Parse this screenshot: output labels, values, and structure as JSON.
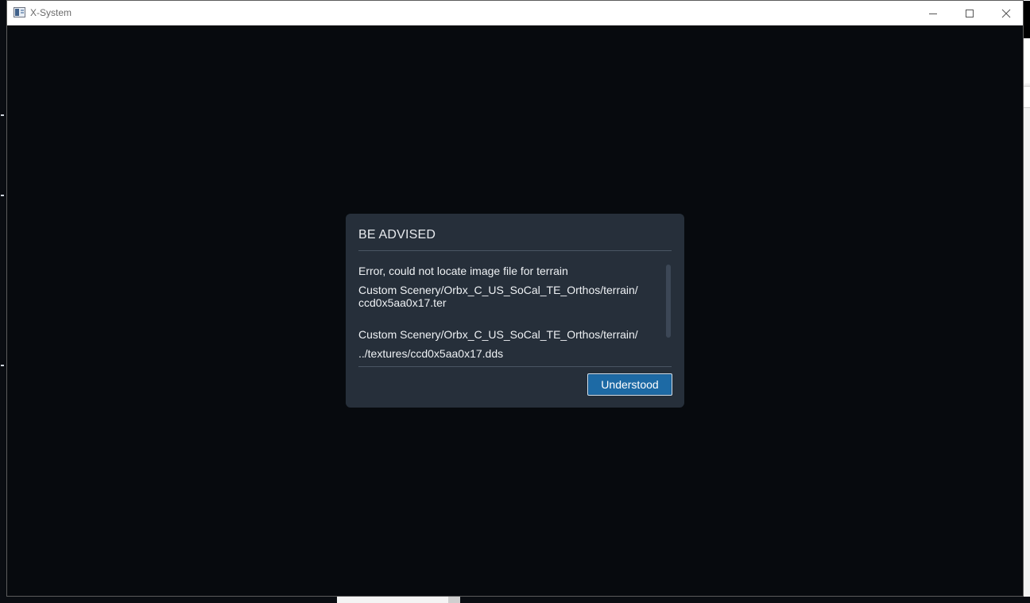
{
  "window": {
    "title": "X-System",
    "controls": [
      "minimize-icon",
      "maximize-icon",
      "close-icon"
    ]
  },
  "dialog": {
    "title": "BE ADVISED",
    "lines": [
      "Error, could not locate image file for terrain",
      "Custom Scenery/Orbx_C_US_SoCal_TE_Orthos/terrain/",
      "ccd0x5aa0x17.ter",
      "Custom Scenery/Orbx_C_US_SoCal_TE_Orthos/terrain/",
      "../textures/ccd0x5aa0x17.dds"
    ],
    "button_label": "Understood"
  },
  "colors": {
    "background": "#070a0e",
    "dialog_bg": "#262f3a",
    "button_bg": "#1d6aa5",
    "text": "#eef1f4"
  }
}
